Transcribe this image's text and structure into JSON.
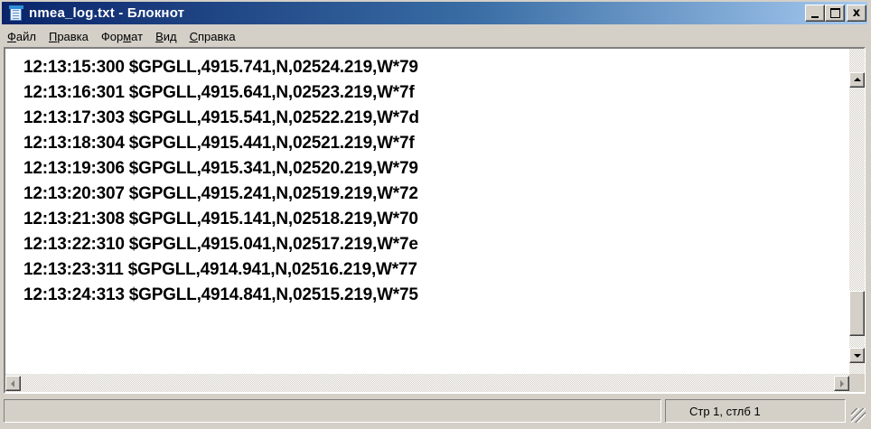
{
  "window": {
    "title": "nmea_log.txt - Блокнот",
    "min_glyph": "_",
    "max_glyph": "□",
    "close_glyph": "x"
  },
  "menu": {
    "items": [
      {
        "key": "Ф",
        "rest": "айл"
      },
      {
        "key": "П",
        "rest": "равка"
      },
      {
        "pre": "Фор",
        "key": "м",
        "rest": "ат"
      },
      {
        "key": "В",
        "rest": "ид"
      },
      {
        "key": "С",
        "rest": "правка"
      }
    ]
  },
  "document": {
    "lines": [
      "12:13:15:300 $GPGLL,4915.741,N,02524.219,W*79",
      "12:13:16:301 $GPGLL,4915.641,N,02523.219,W*7f",
      "12:13:17:303 $GPGLL,4915.541,N,02522.219,W*7d",
      "12:13:18:304 $GPGLL,4915.441,N,02521.219,W*7f",
      "12:13:19:306 $GPGLL,4915.341,N,02520.219,W*79",
      "12:13:20:307 $GPGLL,4915.241,N,02519.219,W*72",
      "12:13:21:308 $GPGLL,4915.141,N,02518.219,W*70",
      "12:13:22:310 $GPGLL,4915.041,N,02517.219,W*7e",
      "12:13:23:311 $GPGLL,4914.941,N,02516.219,W*77",
      "12:13:24:313 $GPGLL,4914.841,N,02515.219,W*75"
    ]
  },
  "status": {
    "left": "",
    "position": "Стр 1, стлб 1"
  },
  "icons": {
    "app": "notepad-icon",
    "minimize": "minimize-icon",
    "maximize": "maximize-icon",
    "close": "close-icon"
  },
  "colors": {
    "titlebar_start": "#0a246a",
    "titlebar_end": "#a6caf0",
    "chrome": "#d4d0c8"
  }
}
